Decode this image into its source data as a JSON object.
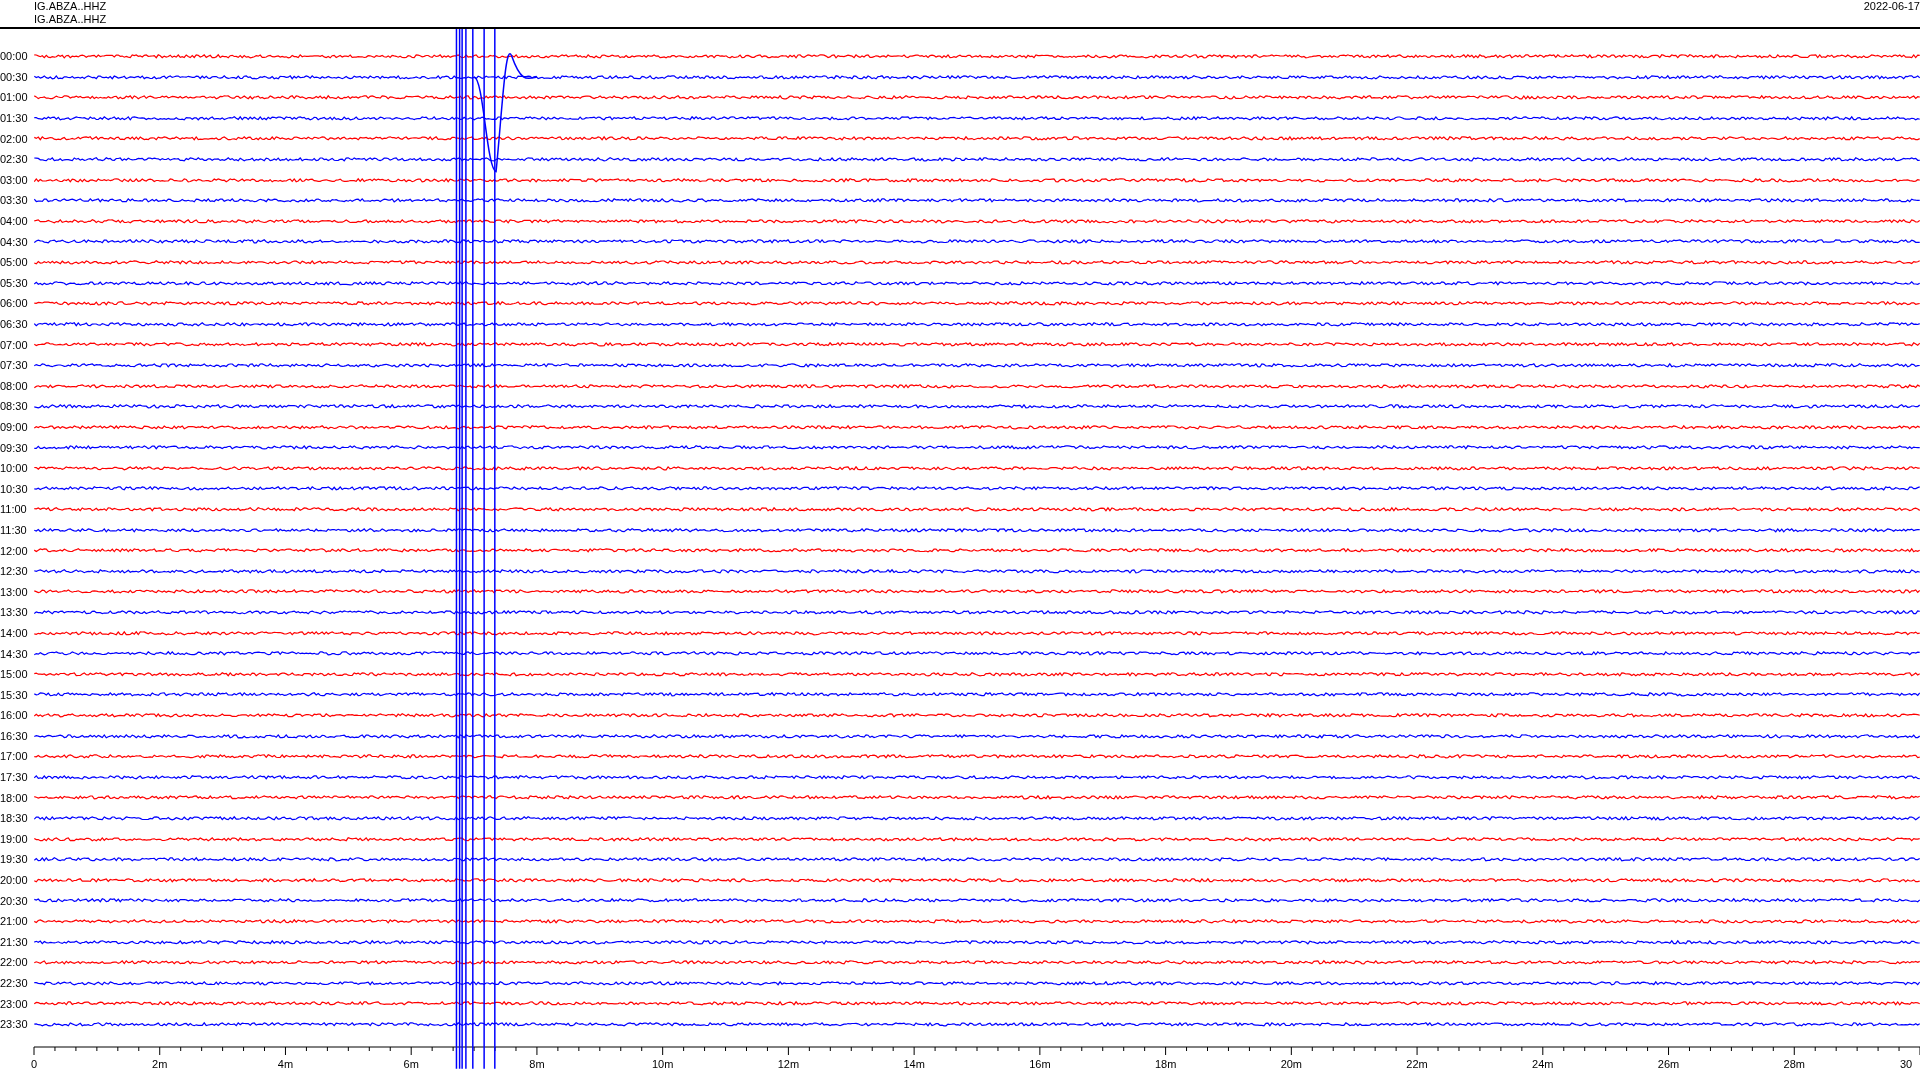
{
  "header": {
    "channel_lines": [
      "IG.ABZA..HHZ",
      "IG.ABZA..HHZ"
    ],
    "date": "2022-06-17"
  },
  "rows": [
    {
      "time": "00:00",
      "color": "#ff0000"
    },
    {
      "time": "00:30",
      "color": "#0000ff"
    },
    {
      "time": "01:00",
      "color": "#ff0000"
    },
    {
      "time": "01:30",
      "color": "#0000ff"
    },
    {
      "time": "02:00",
      "color": "#ff0000"
    },
    {
      "time": "02:30",
      "color": "#0000ff"
    },
    {
      "time": "03:00",
      "color": "#ff0000"
    },
    {
      "time": "03:30",
      "color": "#0000ff"
    },
    {
      "time": "04:00",
      "color": "#ff0000"
    },
    {
      "time": "04:30",
      "color": "#0000ff"
    },
    {
      "time": "05:00",
      "color": "#ff0000"
    },
    {
      "time": "05:30",
      "color": "#0000ff"
    },
    {
      "time": "06:00",
      "color": "#ff0000"
    },
    {
      "time": "06:30",
      "color": "#0000ff"
    },
    {
      "time": "07:00",
      "color": "#ff0000"
    },
    {
      "time": "07:30",
      "color": "#0000ff"
    },
    {
      "time": "08:00",
      "color": "#ff0000"
    },
    {
      "time": "08:30",
      "color": "#0000ff"
    },
    {
      "time": "09:00",
      "color": "#ff0000"
    },
    {
      "time": "09:30",
      "color": "#0000ff"
    },
    {
      "time": "10:00",
      "color": "#ff0000"
    },
    {
      "time": "10:30",
      "color": "#0000ff"
    },
    {
      "time": "11:00",
      "color": "#ff0000"
    },
    {
      "time": "11:30",
      "color": "#0000ff"
    },
    {
      "time": "12:00",
      "color": "#ff0000"
    },
    {
      "time": "12:30",
      "color": "#0000ff"
    },
    {
      "time": "13:00",
      "color": "#ff0000"
    },
    {
      "time": "13:30",
      "color": "#0000ff"
    },
    {
      "time": "14:00",
      "color": "#ff0000"
    },
    {
      "time": "14:30",
      "color": "#0000ff"
    },
    {
      "time": "15:00",
      "color": "#ff0000"
    },
    {
      "time": "15:30",
      "color": "#0000ff"
    },
    {
      "time": "16:00",
      "color": "#ff0000"
    },
    {
      "time": "16:30",
      "color": "#0000ff"
    },
    {
      "time": "17:00",
      "color": "#ff0000"
    },
    {
      "time": "17:30",
      "color": "#0000ff"
    },
    {
      "time": "18:00",
      "color": "#ff0000"
    },
    {
      "time": "18:30",
      "color": "#0000ff"
    },
    {
      "time": "19:00",
      "color": "#ff0000"
    },
    {
      "time": "19:30",
      "color": "#0000ff"
    },
    {
      "time": "20:00",
      "color": "#ff0000"
    },
    {
      "time": "20:30",
      "color": "#0000ff"
    },
    {
      "time": "21:00",
      "color": "#ff0000"
    },
    {
      "time": "21:30",
      "color": "#0000ff"
    },
    {
      "time": "22:00",
      "color": "#ff0000"
    },
    {
      "time": "22:30",
      "color": "#0000ff"
    },
    {
      "time": "23:00",
      "color": "#ff0000"
    },
    {
      "time": "23:30",
      "color": "#0000ff"
    }
  ],
  "x_axis": {
    "labels": [
      "0",
      "2m",
      "4m",
      "6m",
      "8m",
      "10m",
      "12m",
      "14m",
      "16m",
      "18m",
      "20m",
      "22m",
      "24m",
      "26m",
      "28m",
      "30"
    ]
  }
}
